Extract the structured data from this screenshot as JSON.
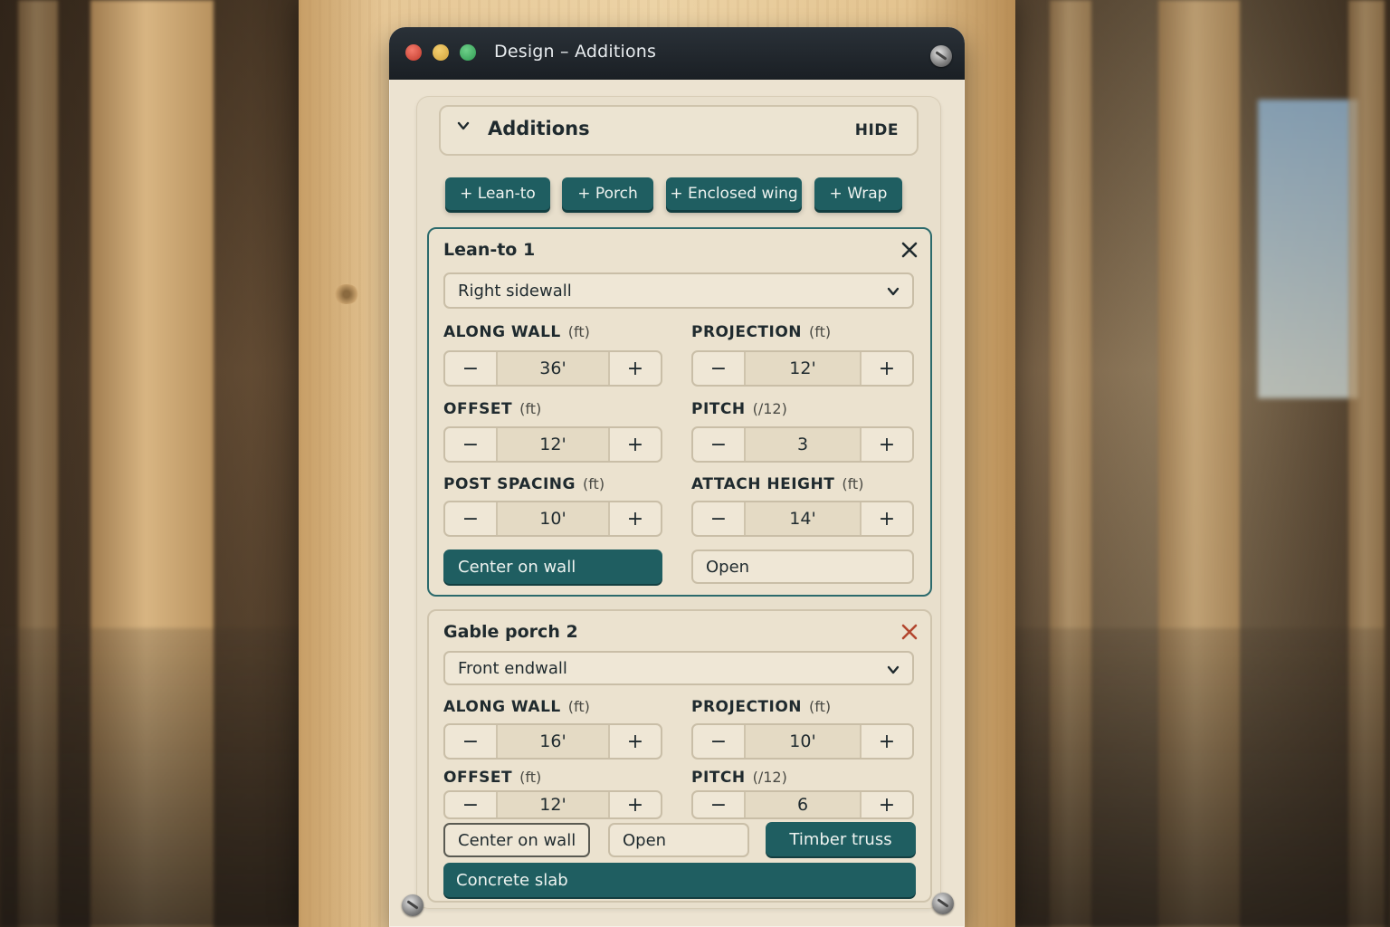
{
  "window": {
    "title": "Design – Additions"
  },
  "section": {
    "title": "Additions",
    "hide_label": "HIDE"
  },
  "add_buttons": [
    "+ Lean-to",
    "+ Porch",
    "+ Enclosed wing",
    "+ Wrap"
  ],
  "cards": [
    {
      "title": "Lean-to 1",
      "wall": "Right sidewall",
      "fields": [
        {
          "label": "ALONG WALL",
          "unit": "(ft)",
          "value": "36'"
        },
        {
          "label": "PROJECTION",
          "unit": "(ft)",
          "value": "12'"
        },
        {
          "label": "OFFSET",
          "unit": "(ft)",
          "value": "12'"
        },
        {
          "label": "PITCH",
          "unit": "(/12)",
          "value": "3"
        },
        {
          "label": "POST SPACING",
          "unit": "(ft)",
          "value": "10'"
        },
        {
          "label": "ATTACH HEIGHT",
          "unit": "(ft)",
          "value": "14'"
        }
      ],
      "center_label": "Center on wall",
      "mode_label": "Open"
    },
    {
      "title": "Gable porch 2",
      "wall": "Front endwall",
      "fields": [
        {
          "label": "ALONG WALL",
          "unit": "(ft)",
          "value": "16'"
        },
        {
          "label": "PROJECTION",
          "unit": "(ft)",
          "value": "10'"
        },
        {
          "label": "OFFSET",
          "unit": "(ft)",
          "value": "12'"
        },
        {
          "label": "PITCH",
          "unit": "(/12)",
          "value": "6"
        }
      ],
      "center_label": "Center on wall",
      "mode_label": "Open",
      "truss_label": "Timber truss",
      "floor_label": "Concrete slab"
    }
  ],
  "stepper": {
    "minus": "−",
    "plus": "+"
  },
  "colors": {
    "accent": "#1f5e61",
    "panel": "#e8dfcc",
    "titlebar": "#1a1f24",
    "close_red": "#b3472f"
  }
}
